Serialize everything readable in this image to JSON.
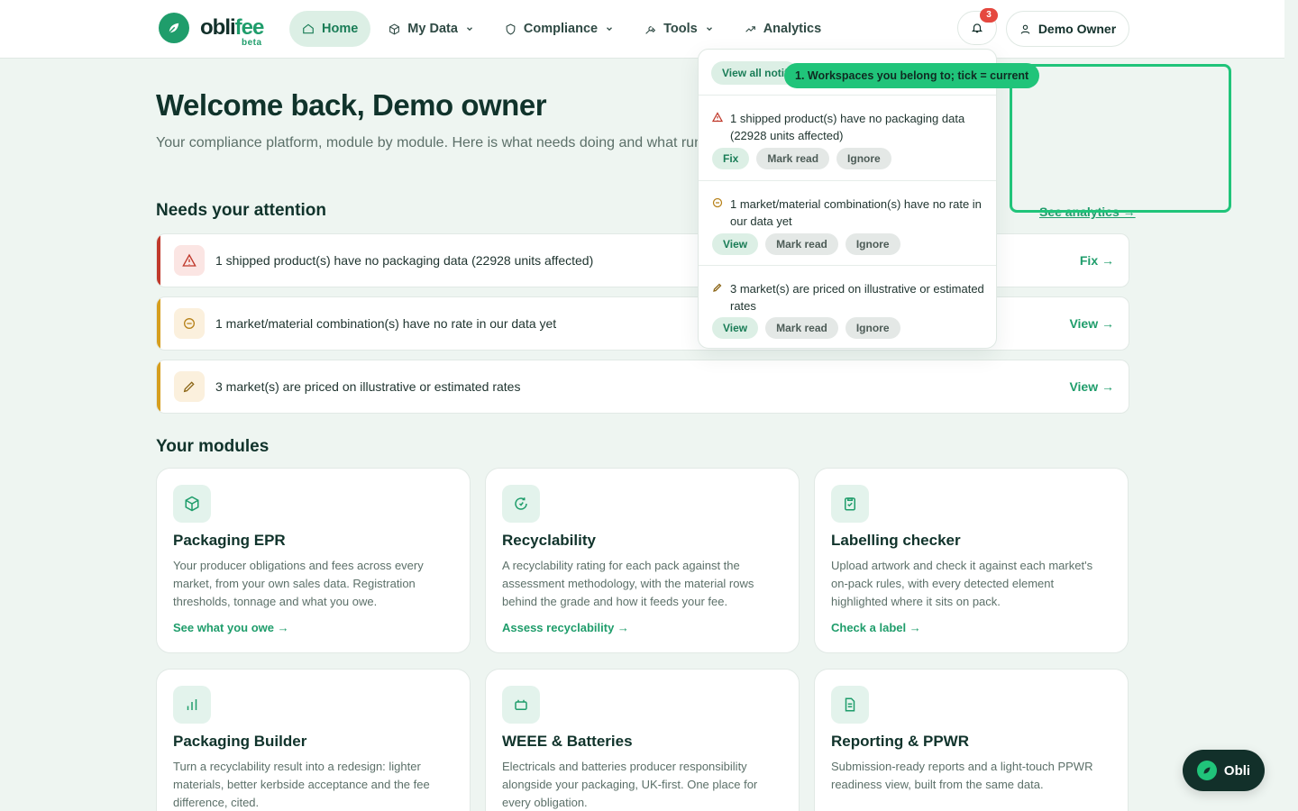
{
  "brand": {
    "name_main": "obli",
    "name_accent": "fee",
    "tag": "beta"
  },
  "nav": {
    "items": [
      {
        "label": "Home",
        "icon": "home-icon",
        "active": true
      },
      {
        "label": "My Data",
        "icon": "cube-icon"
      },
      {
        "label": "Compliance",
        "icon": "shield-icon"
      },
      {
        "label": "Tools",
        "icon": "wrench-icon"
      },
      {
        "label": "Analytics",
        "icon": "trend-icon"
      }
    ],
    "notification_count": "3",
    "user_label": "Demo Owner"
  },
  "welcome": {
    "title": "Welcome back, Demo owner",
    "subtitle": "Your compliance platform, module by module. Here is what needs doing and what run."
  },
  "attention": {
    "heading": "Needs your attention",
    "see_analytics": "See analytics →",
    "rows": [
      {
        "text": "1 shipped product(s) have no packaging data (22928 units affected)",
        "action": "Fix →",
        "severity": "error"
      },
      {
        "text": "1 market/material combination(s) have no rate in our data yet",
        "action": "View →",
        "severity": "warning"
      },
      {
        "text": "3 market(s) are priced on illustrative or estimated rates",
        "action": "View →",
        "severity": "warning"
      }
    ]
  },
  "modules": {
    "heading": "Your modules",
    "cards": [
      {
        "title": "Packaging EPR",
        "icon": "box-icon",
        "desc": "Your producer obligations and fees across every market, from your own sales data. Registration thresholds, tonnage and what you owe.",
        "link": "See what you owe →"
      },
      {
        "title": "Recyclability",
        "icon": "recycle-icon",
        "desc": "A recyclability rating for each pack against the assessment methodology, with the material rows behind the grade and how it feeds your fee.",
        "link": "Assess recyclability →"
      },
      {
        "title": "Labelling checker",
        "icon": "clipboard-check-icon",
        "desc": "Upload artwork and check it against each market's on-pack rules, with every detected element highlighted where it sits on pack.",
        "link": "Check a label →"
      },
      {
        "title": "Packaging Builder",
        "icon": "bar-chart-icon",
        "desc": "Turn a recyclability result into a redesign: lighter materials, better kerbside acceptance and the fee difference, cited.",
        "link": ""
      },
      {
        "title": "WEEE & Batteries",
        "icon": "battery-icon",
        "desc": "Electricals and batteries producer responsibility alongside your packaging, UK-first. One place for every obligation.",
        "link": ""
      },
      {
        "title": "Reporting & PPWR",
        "icon": "document-icon",
        "desc": "Submission-ready reports and a light-touch PPWR readiness view, built from the same data.",
        "link": ""
      }
    ]
  },
  "notifications": {
    "view_all": "View all notifications",
    "items": [
      {
        "text": "1 shipped product(s) have no packaging data (22928 units affected)",
        "icon": "warning-icon",
        "actions": [
          "Fix",
          "Mark read",
          "Ignore"
        ]
      },
      {
        "text": "1 market/material combination(s) have no rate in our data yet",
        "icon": "minus-circle-icon",
        "actions": [
          "View",
          "Mark read",
          "Ignore"
        ]
      },
      {
        "text": "3 market(s) are priced on illustrative or estimated rates",
        "icon": "pencil-icon",
        "actions": [
          "View",
          "Mark read",
          "Ignore"
        ]
      }
    ]
  },
  "tour": {
    "tip": "1. Workspaces you belong to; tick = current"
  },
  "assistant": {
    "label": "Obli"
  },
  "colors": {
    "brand": "#1f9d6b",
    "error": "#c0392b",
    "warning": "#d69e1e",
    "tour": "#20c47a",
    "badge": "#e5483f"
  }
}
